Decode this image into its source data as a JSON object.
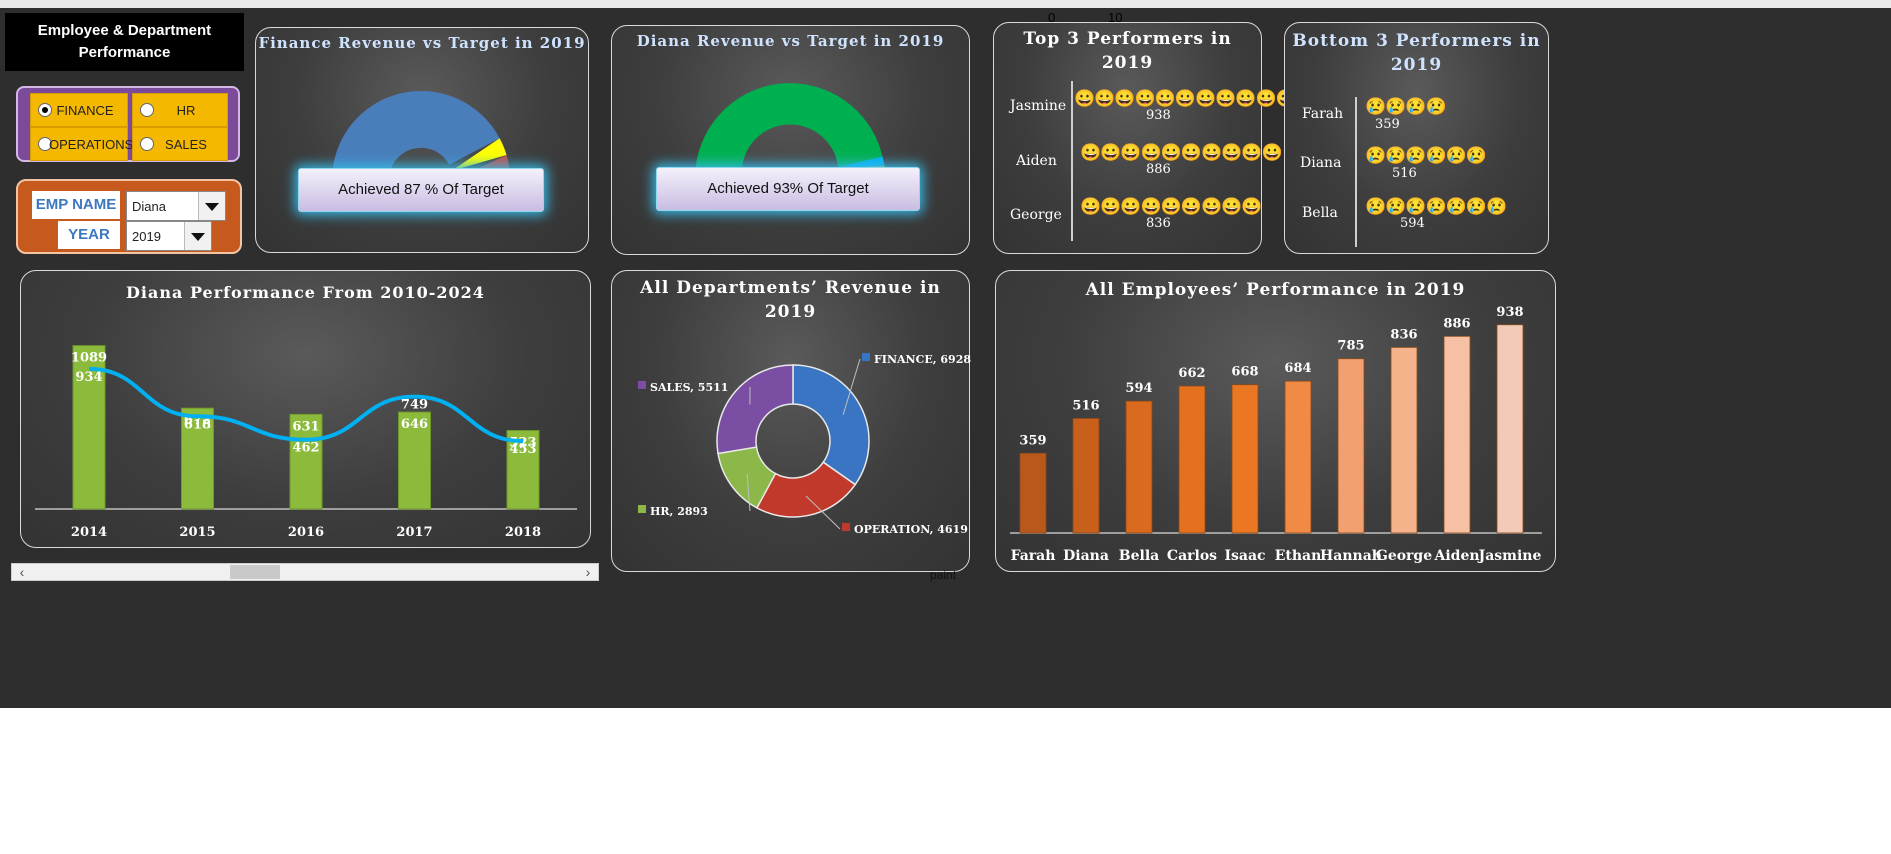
{
  "header": {
    "title_line1": "Employee & Department",
    "title_line2": "Performance"
  },
  "top_ticks": [
    "0",
    "10"
  ],
  "department_options": [
    {
      "label": "FINANCE",
      "selected": true
    },
    {
      "label": "HR",
      "selected": false
    },
    {
      "label": "OPERATIONS",
      "selected": false
    },
    {
      "label": "SALES",
      "selected": false
    }
  ],
  "filters": {
    "emp_name_label": "EMP NAME",
    "emp_name_value": "Diana",
    "year_label": "YEAR",
    "year_value": "2019"
  },
  "gauge_finance": {
    "title": "Finance Revenue vs Target in 2019",
    "achieved_text": "Achieved 87 % Of Target",
    "achieved_fraction": 0.87,
    "colors": {
      "main": "#4a7ebb",
      "marker": "#ffff00",
      "rest": "#c0504d"
    }
  },
  "gauge_employee": {
    "title": "Diana   Revenue vs Target in 2019",
    "achieved_text": "Achieved 93% Of Target",
    "achieved_fraction": 0.93,
    "colors": {
      "main": "#00b050",
      "marker": "#00b0f0",
      "rest": "#ffc000"
    }
  },
  "top3": {
    "title_line1": "Top 3 Performers in",
    "title_line2": "2019",
    "emoji": "😀",
    "rows": [
      {
        "name": "Jasmine",
        "value": "938",
        "count": 11
      },
      {
        "name": "Aiden",
        "value": "886",
        "count": 10
      },
      {
        "name": "George",
        "value": "836",
        "count": 9
      }
    ]
  },
  "bottom3": {
    "title_line1": "Bottom 3 Performers in",
    "title_line2": "2019",
    "emoji": "😢",
    "rows": [
      {
        "name": "Farah",
        "value": "359",
        "count": 4
      },
      {
        "name": "Diana",
        "value": "516",
        "count": 6
      },
      {
        "name": "Bella",
        "value": "594",
        "count": 7
      }
    ]
  },
  "chart_data": [
    {
      "type": "bar",
      "title": "Diana   Performance From 2010-2024",
      "categories": [
        "2014",
        "2015",
        "2016",
        "2017",
        "2018"
      ],
      "series": [
        {
          "type": "bar",
          "values": [
            1089,
            672,
            631,
            646,
            523
          ],
          "color": "#8cbb3c"
        },
        {
          "type": "line",
          "values": [
            934,
            618,
            462,
            749,
            453
          ],
          "color": "#00b0f0"
        }
      ],
      "ylim": [
        0,
        1200
      ]
    },
    {
      "type": "pie",
      "title_line1": "All Departments’ Revenue in",
      "title_line2": "2019",
      "slices": [
        {
          "label": "FINANCE",
          "value": 6928,
          "color": "#3a75c4"
        },
        {
          "label": "OPERATION",
          "value": 4619,
          "color": "#c0392b"
        },
        {
          "label": "HR",
          "value": 2893,
          "color": "#8bb849"
        },
        {
          "label": "SALES",
          "value": 5511,
          "color": "#7a4fa3"
        }
      ]
    },
    {
      "type": "bar",
      "title": "All Employees’ Performance in 2019",
      "categories": [
        "Farah",
        "Diana",
        "Bella",
        "Carlos",
        "Isaac",
        "Ethan",
        "Hannah",
        "George",
        "Aiden",
        "Jasmine"
      ],
      "values": [
        359,
        516,
        594,
        662,
        668,
        684,
        785,
        836,
        886,
        938
      ],
      "colors": [
        "#b8581a",
        "#c8601b",
        "#d96a1e",
        "#e5711f",
        "#ec7722",
        "#f08a45",
        "#f3a070",
        "#f5b38c",
        "#f5c0a4",
        "#f3c9b7"
      ],
      "ylim": [
        0,
        1000
      ]
    }
  ],
  "footer_fragment": "paint"
}
